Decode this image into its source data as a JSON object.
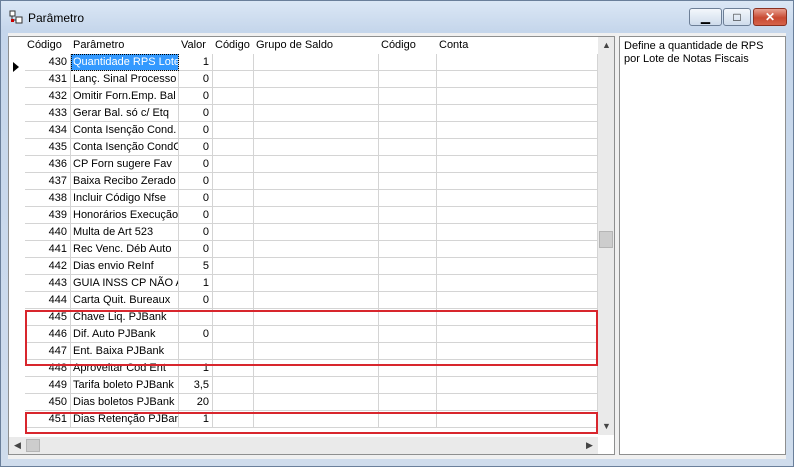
{
  "window": {
    "title": "Parâmetro"
  },
  "grid": {
    "columns": [
      "Código",
      "Parâmetro",
      "Valor",
      "Código",
      "Grupo de Saldo",
      "Código",
      "Conta"
    ],
    "rows": [
      {
        "codigo": "430",
        "parametro": "Quantidade RPS Lote",
        "valor": "1"
      },
      {
        "codigo": "431",
        "parametro": "Lanç. Sinal Processo",
        "valor": "0"
      },
      {
        "codigo": "432",
        "parametro": "Omitir Forn.Emp. Bal",
        "valor": "0"
      },
      {
        "codigo": "433",
        "parametro": "Gerar Bal. só c/ Etq",
        "valor": "0"
      },
      {
        "codigo": "434",
        "parametro": "Conta Isenção Cond.",
        "valor": "0"
      },
      {
        "codigo": "435",
        "parametro": "Conta Isenção CondC",
        "valor": "0"
      },
      {
        "codigo": "436",
        "parametro": "CP Forn sugere Fav",
        "valor": "0"
      },
      {
        "codigo": "437",
        "parametro": "Baixa Recibo Zerado",
        "valor": "0"
      },
      {
        "codigo": "438",
        "parametro": "Incluir Código Nfse",
        "valor": "0"
      },
      {
        "codigo": "439",
        "parametro": "Honorários Execução",
        "valor": "0"
      },
      {
        "codigo": "440",
        "parametro": "Multa de Art 523",
        "valor": "0"
      },
      {
        "codigo": "441",
        "parametro": "Rec Venc. Déb Auto",
        "valor": "0"
      },
      {
        "codigo": "442",
        "parametro": "Dias envio ReInf",
        "valor": "5"
      },
      {
        "codigo": "443",
        "parametro": "GUIA INSS CP NÃO A",
        "valor": "1"
      },
      {
        "codigo": "444",
        "parametro": "Carta Quit. Bureaux",
        "valor": "0"
      },
      {
        "codigo": "445",
        "parametro": "Chave Liq. PJBank",
        "valor": ""
      },
      {
        "codigo": "446",
        "parametro": "Dif. Auto PJBank",
        "valor": "0"
      },
      {
        "codigo": "447",
        "parametro": "Ent. Baixa PJBank",
        "valor": ""
      },
      {
        "codigo": "448",
        "parametro": "Aproveitar Cod Ent",
        "valor": "1"
      },
      {
        "codigo": "449",
        "parametro": "Tarifa boleto PJBank",
        "valor": "3,5"
      },
      {
        "codigo": "450",
        "parametro": "Dias boletos PJBank",
        "valor": "20"
      },
      {
        "codigo": "451",
        "parametro": "Dias Retenção PJBank",
        "valor": "1"
      }
    ]
  },
  "description": {
    "text": "Define a quantidade de RPS por Lote de Notas Fiscais"
  },
  "colors": {
    "selection": "#3399ff",
    "highlight": "#d8262d"
  },
  "icons": {
    "window": "parameter-window-icon",
    "minimize": "minimize-icon",
    "maximize": "maximize-icon",
    "close": "close-icon"
  }
}
